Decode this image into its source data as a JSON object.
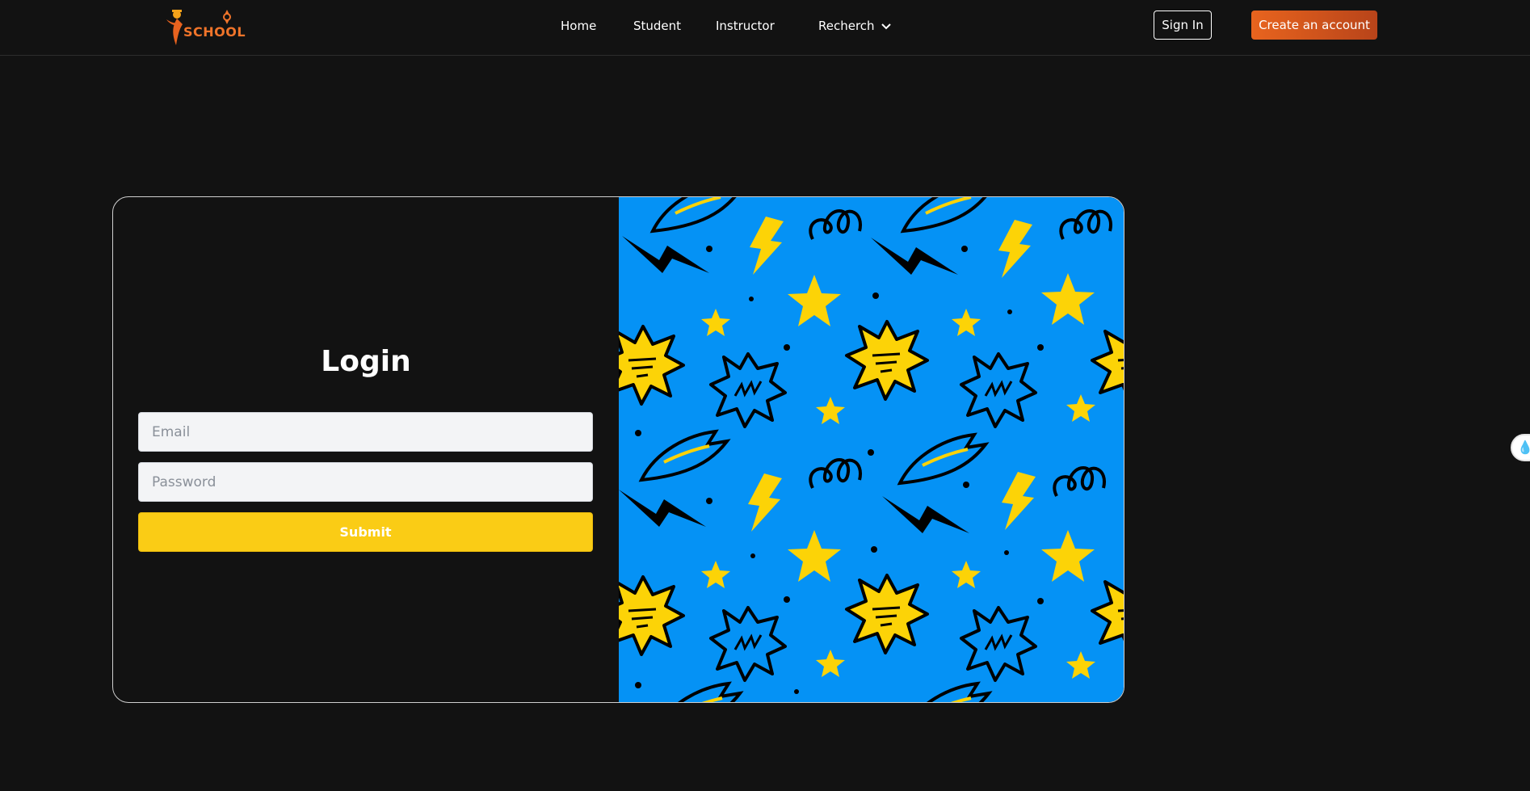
{
  "brand": {
    "logo_text": "SCHOOL",
    "logo_color": "#f0742a"
  },
  "nav": {
    "links": [
      "Home",
      "Student",
      "Instructor",
      "Recherch"
    ],
    "dropdown_icon": "chevron-down-icon"
  },
  "header_actions": {
    "signin_label": "Sign In",
    "create_label": "Create an account",
    "create_color": "#e8641e"
  },
  "login": {
    "title": "Login",
    "email_placeholder": "Email",
    "password_placeholder": "Password",
    "submit_label": "Submit",
    "submit_color": "#facc15"
  },
  "illustration": {
    "background_color": "#0592f5",
    "accent_color": "#fcd307"
  },
  "side_widget": {
    "icon": "water-drop-icon"
  }
}
